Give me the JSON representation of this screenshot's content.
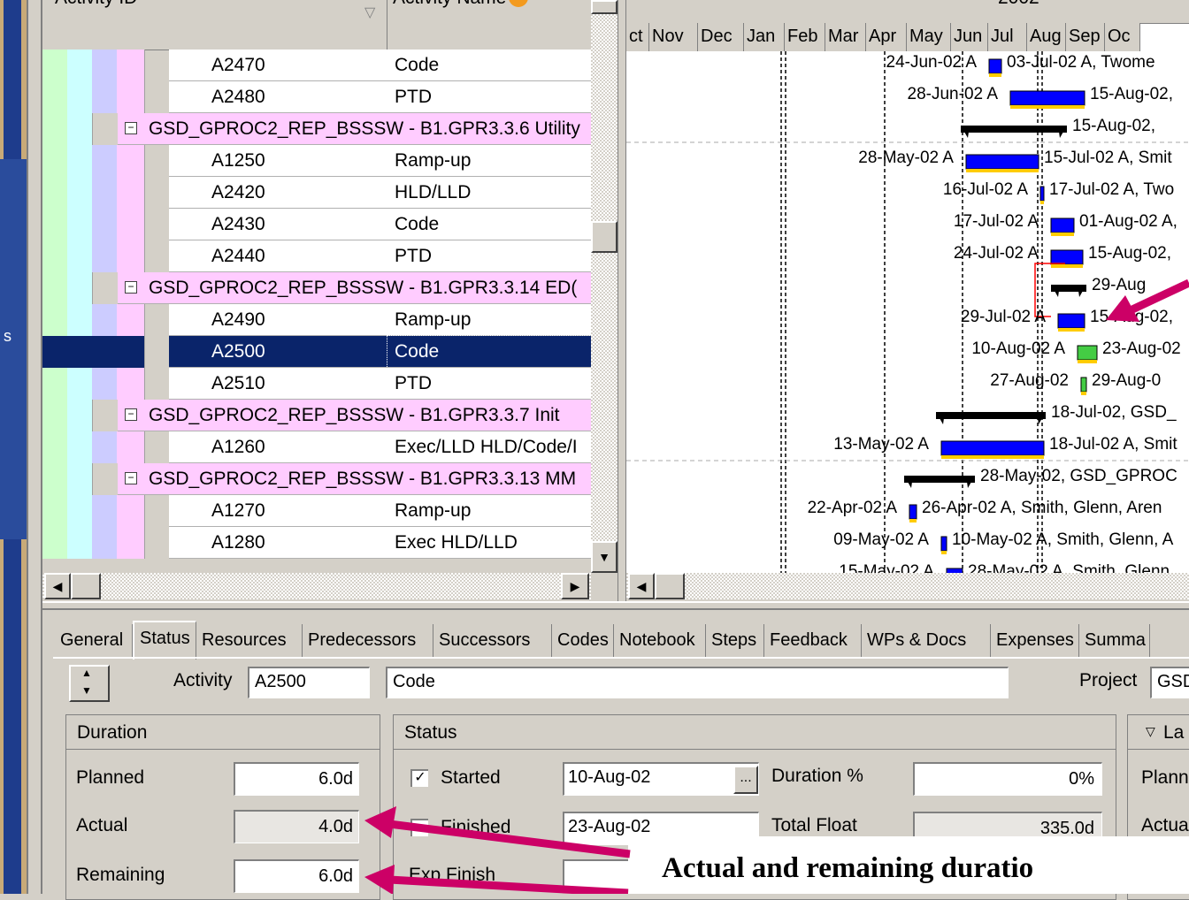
{
  "grid": {
    "col_activity_id": "Activity ID",
    "col_activity_name": "Activity Name",
    "rows": [
      {
        "id": "A2470",
        "name": "Code"
      },
      {
        "id": "A2480",
        "name": "PTD"
      },
      {
        "group": "GSD_GPROC2_REP_BSSSW - B1.GPR3.3.6  Utility"
      },
      {
        "id": "A1250",
        "name": "Ramp-up"
      },
      {
        "id": "A2420",
        "name": "HLD/LLD"
      },
      {
        "id": "A2430",
        "name": "Code"
      },
      {
        "id": "A2440",
        "name": "PTD"
      },
      {
        "group": "GSD_GPROC2_REP_BSSSW - B1.GPR3.3.14  ED("
      },
      {
        "id": "A2490",
        "name": "Ramp-up"
      },
      {
        "id": "A2500",
        "name": "Code",
        "selected": true
      },
      {
        "id": "A2510",
        "name": "PTD"
      },
      {
        "group": "GSD_GPROC2_REP_BSSSW - B1.GPR3.3.7  Init"
      },
      {
        "id": "A1260",
        "name": "Exec/LLD HLD/Code/I"
      },
      {
        "group": "GSD_GPROC2_REP_BSSSW - B1.GPR3.3.13  MM"
      },
      {
        "id": "A1270",
        "name": "Ramp-up"
      },
      {
        "id": "A1280",
        "name": "Exec HLD/LLD"
      }
    ]
  },
  "gantt": {
    "year": "2002",
    "months": [
      "ct",
      "Nov",
      "Dec",
      "Jan",
      "Feb",
      "Mar",
      "Apr",
      "May",
      "Jun",
      "Jul",
      "Aug",
      "Sep",
      "Oc"
    ],
    "labels": [
      {
        "left": "24-Jun-02 A",
        "right": "03-Jul-02 A, Twome"
      },
      {
        "left": "28-Jun-02 A",
        "right": "15-Aug-02,"
      },
      {
        "left": "",
        "right": "15-Aug-02,"
      },
      {
        "left": "28-May-02 A",
        "right": "15-Jul-02 A, Smit"
      },
      {
        "left": "16-Jul-02 A",
        "right": "17-Jul-02 A, Two"
      },
      {
        "left": "17-Jul-02 A",
        "right": "01-Aug-02 A,"
      },
      {
        "left": "24-Jul-02 A",
        "right": "15-Aug-02,"
      },
      {
        "left": "",
        "right": "29-Aug"
      },
      {
        "left": "29-Jul-02 A",
        "right": "15-Aug-02,"
      },
      {
        "left": "10-Aug-02 A",
        "right": "23-Aug-02"
      },
      {
        "left": "27-Aug-02",
        "right": "29-Aug-0"
      },
      {
        "left": "",
        "right": "18-Jul-02, GSD_"
      },
      {
        "left": "13-May-02 A",
        "right": "18-Jul-02 A, Smit"
      },
      {
        "left": "",
        "right": "28-May-02, GSD_GPROC"
      },
      {
        "left": "22-Apr-02 A",
        "right": "26-Apr-02 A, Smith, Glenn, Aren"
      },
      {
        "left": "09-May-02 A",
        "right": "10-May-02 A, Smith, Glenn, A"
      },
      {
        "left": "15-May-02 A",
        "right": "28-May-02 A, Smith, Glenn"
      }
    ],
    "colors": {
      "bar": "#0000ff",
      "summary": "#000000",
      "link": "#ff0000",
      "arrow": "#cc0066"
    }
  },
  "tabs": [
    "General",
    "Status",
    "Resources",
    "Predecessors",
    "Successors",
    "Codes",
    "Notebook",
    "Steps",
    "Feedback",
    "WPs & Docs",
    "Expenses",
    "Summa"
  ],
  "details": {
    "activity_label": "Activity",
    "activity_id": "A2500",
    "activity_name": "Code",
    "project_label": "Project",
    "project_value": "GSD",
    "duration": {
      "title": "Duration",
      "planned_label": "Planned",
      "planned": "6.0d",
      "actual_label": "Actual",
      "actual": "4.0d",
      "remaining_label": "Remaining",
      "remaining": "6.0d"
    },
    "status": {
      "title": "Status",
      "started_label": "Started",
      "started_date": "10-Aug-02",
      "finished_label": "Finished",
      "finished_date": "23-Aug-02",
      "exp_finish_label": "Exp Finish",
      "duration_pct_label": "Duration %",
      "duration_pct": "0%",
      "total_float_label": "Total Float",
      "total_float": "335.0d",
      "browse": "..."
    },
    "labor": {
      "title": "La",
      "planned_label": "Plann",
      "actual_label": "Actua"
    }
  },
  "caption": "Actual and remaining duratio"
}
